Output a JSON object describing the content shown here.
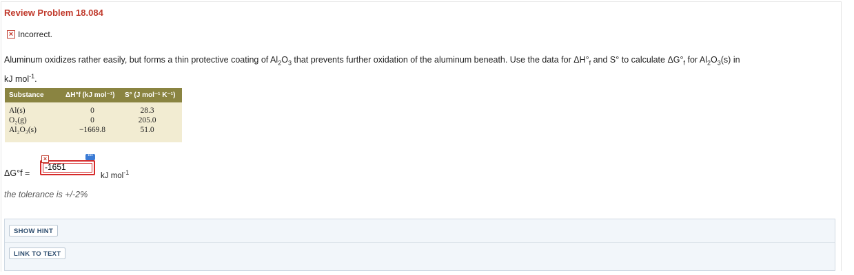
{
  "header": {
    "title": "Review Problem 18.084"
  },
  "status": {
    "icon": "incorrect-x-icon",
    "text": "Incorrect."
  },
  "question": {
    "line1_a": "Aluminum oxidizes rather easily, but forms a thin protective coating of Al",
    "line1_sub1": "2",
    "line1_b": "O",
    "line1_sub2": "3",
    "line1_c": " that prevents further oxidation of the aluminum beneath. Use the data for ΔH°",
    "line1_subf1": "f",
    "line1_d": " and S° to calculate ΔG°",
    "line1_subf2": "f",
    "line1_e": " for Al",
    "line1_sub3": "2",
    "line1_f": "O",
    "line1_sub4": "3",
    "line1_g": "(s) in",
    "line2_a": "kJ mol",
    "line2_sup": "-1",
    "line2_b": "."
  },
  "table": {
    "headers": [
      "Substance",
      "ΔH°f (kJ mol⁻¹)",
      "S° (J mol⁻¹ K⁻¹)"
    ],
    "rows": [
      {
        "substance": "Al(s)",
        "dh": "0",
        "s": "28.3"
      },
      {
        "substance": "O₂(g)",
        "dh": "0",
        "s": "205.0"
      },
      {
        "substance": "Al₂O₃(s)",
        "dh": "−1669.8",
        "s": "51.0"
      }
    ]
  },
  "answer": {
    "label": "ΔG°f =",
    "value": "-1651",
    "unit_a": "kJ mol",
    "unit_sup": "-1"
  },
  "tolerance": "the tolerance is +/-2%",
  "buttons": {
    "hint": "SHOW HINT",
    "link": "LINK TO TEXT"
  },
  "colors": {
    "title": "#c0392b",
    "table_header": "#8a8441",
    "table_body": "#f2ecd2",
    "error_red": "#d62a2a"
  }
}
